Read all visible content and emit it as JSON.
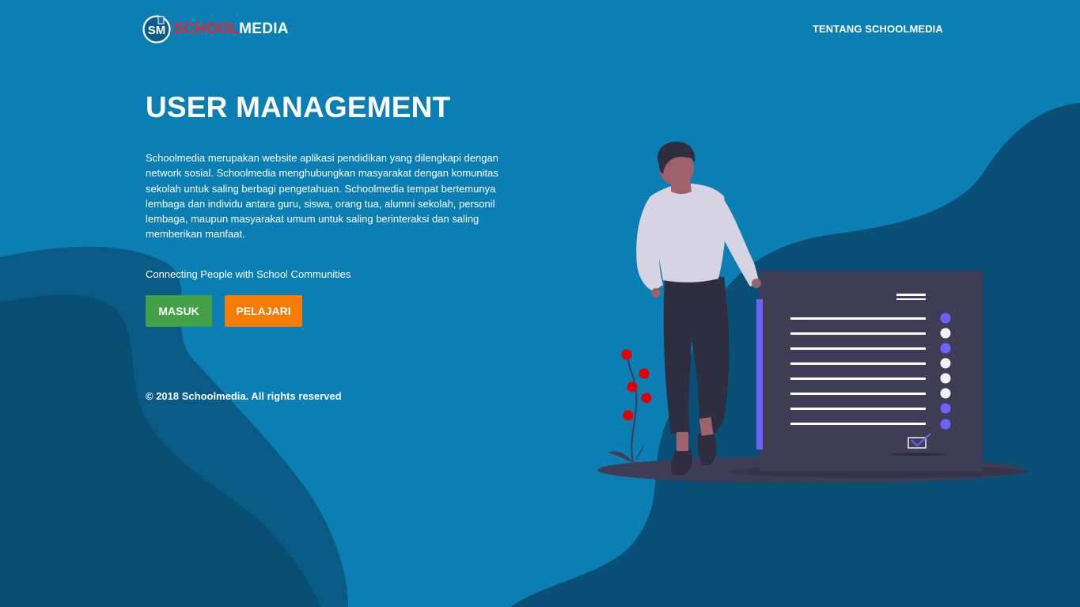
{
  "brand": {
    "logo_initials": "SM",
    "name_part1": "SCHOOL",
    "name_part2": "MEDIA"
  },
  "nav": {
    "about_label": "TENTANG SCHOOLMEDIA"
  },
  "hero": {
    "title": "USER MANAGEMENT",
    "description": "Schoolmedia merupakan website aplikasi pendidikan yang dilengkapi dengan network sosial. Schoolmedia menghubungkan masyarakat dengan komunitas sekolah untuk saling berbagi pengetahuan. Schoolmedia tempat bertemunya lembaga dan individu antara guru, siswa, orang tua, alumni sekolah, personil lembaga, maupun masyarakat umum untuk saling berinteraksi dan saling memberikan manfaat.",
    "tagline": "Connecting People with School Communities",
    "login_label": "MASUK",
    "learn_label": "PELAJARI"
  },
  "footer": {
    "copyright": "© 2018 Schoolmedia. All rights reserved"
  },
  "colors": {
    "background": "#0b7fb3",
    "wave_dark": "#0a3d5e",
    "login_button": "#43a047",
    "learn_button": "#f57c00",
    "brand_red": "#e8242b",
    "doc_panel": "#3f3d56",
    "accent_purple": "#6c63ff",
    "flower_red": "#e00000"
  },
  "illustration": {
    "name": "person-with-checklist-document"
  }
}
